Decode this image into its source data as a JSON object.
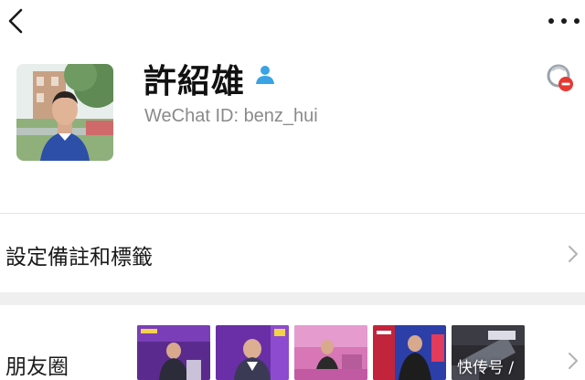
{
  "header": {
    "back_icon": "chevron-left-icon",
    "more_icon": "more-horizontal-icon"
  },
  "profile": {
    "name": "許紹雄",
    "gender_icon": "user-silhouette-icon",
    "gender_color": "#3aa3e3",
    "wechat_id_label": "WeChat ID:",
    "wechat_id_value": "benz_hui",
    "block_icon": "blocked-contact-icon",
    "block_color": "#e53935"
  },
  "rows": {
    "remark_tags": "設定備註和標籤",
    "moments": "朋友圈"
  },
  "moments_thumbnails": [
    {
      "palette": "purple-stage"
    },
    {
      "palette": "purple-stage-2"
    },
    {
      "palette": "pink-stage"
    },
    {
      "palette": "red-crowd"
    },
    {
      "palette": "dark-sign"
    }
  ],
  "watermark": "快传号 / "
}
